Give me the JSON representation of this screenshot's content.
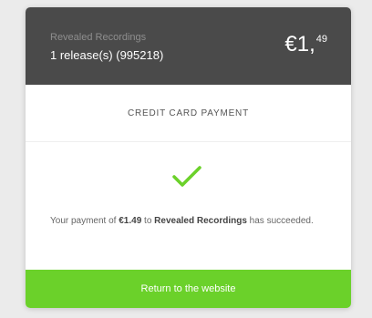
{
  "header": {
    "merchant_name": "Revealed Recordings",
    "release_info": "1 release(s) (995218)",
    "price_main": "€1,",
    "price_cents": "49"
  },
  "payment": {
    "section_title": "CREDIT CARD PAYMENT",
    "status_icon": "checkmark-icon",
    "message_prefix": "Your payment of ",
    "message_amount": "€1.49",
    "message_middle": " to ",
    "message_merchant": "Revealed Recordings",
    "message_suffix": " has succeeded."
  },
  "actions": {
    "return_label": "Return to the website"
  },
  "colors": {
    "header_bg": "#4a4a4a",
    "accent_green": "#6bd12a",
    "background": "#ebebeb"
  }
}
